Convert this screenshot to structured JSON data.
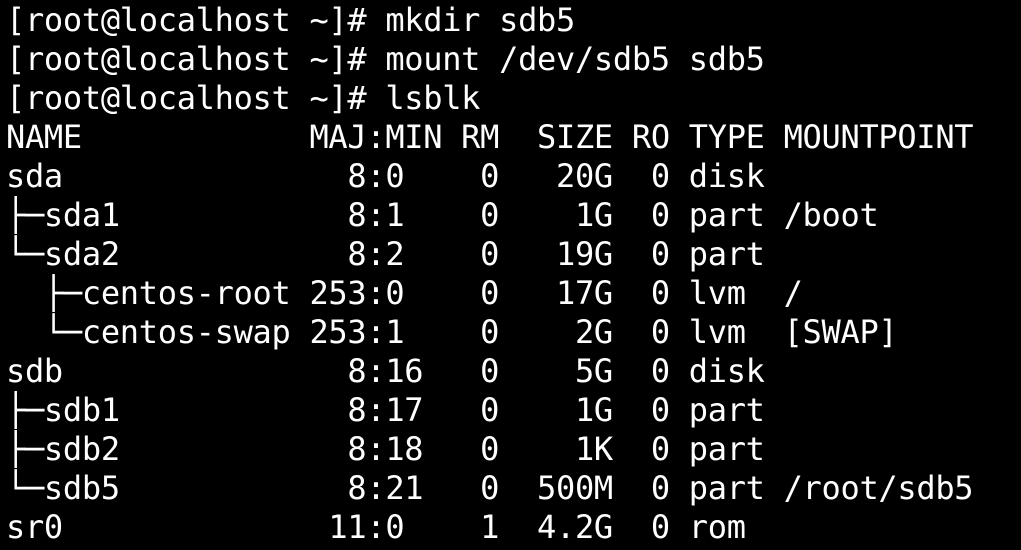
{
  "terminal": {
    "colors": {
      "background": "#000000",
      "foreground": "#ffffff"
    },
    "lines": [
      "[root@localhost ~]# mkdir sdb5",
      "[root@localhost ~]# mount /dev/sdb5 sdb5",
      "[root@localhost ~]# lsblk",
      "NAME            MAJ:MIN RM  SIZE RO TYPE MOUNTPOINT",
      "sda               8:0    0   20G  0 disk",
      "├─sda1            8:1    0    1G  0 part /boot",
      "└─sda2            8:2    0   19G  0 part",
      "  ├─centos-root 253:0    0   17G  0 lvm  /",
      "  └─centos-swap 253:1    0    2G  0 lvm  [SWAP]",
      "sdb               8:16   0    5G  0 disk",
      "├─sdb1            8:17   0    1G  0 part",
      "├─sdb2            8:18   0    1K  0 part",
      "└─sdb5            8:21   0  500M  0 part /root/sdb5",
      "sr0              11:0    1  4.2G  0 rom"
    ]
  }
}
